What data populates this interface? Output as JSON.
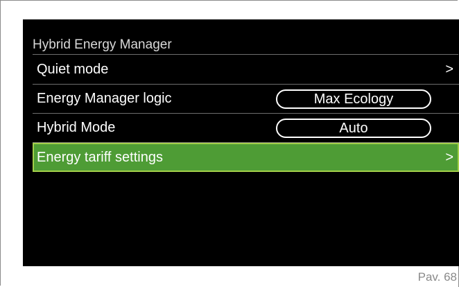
{
  "menu": {
    "title": "Hybrid Energy Manager",
    "items": [
      {
        "label": "Quiet mode",
        "chevron": ">"
      },
      {
        "label": "Energy Manager logic",
        "value": "Max Ecology"
      },
      {
        "label": "Hybrid Mode",
        "value": "Auto"
      },
      {
        "label": "Energy tariff settings",
        "chevron": ">",
        "selected": true
      }
    ]
  },
  "footer": {
    "page": "Pav. 68"
  },
  "colors": {
    "screen_bg": "#000000",
    "highlight_bg": "#4e9c35",
    "highlight_border": "#a4cf4a",
    "separator": "#6e6e6e"
  }
}
